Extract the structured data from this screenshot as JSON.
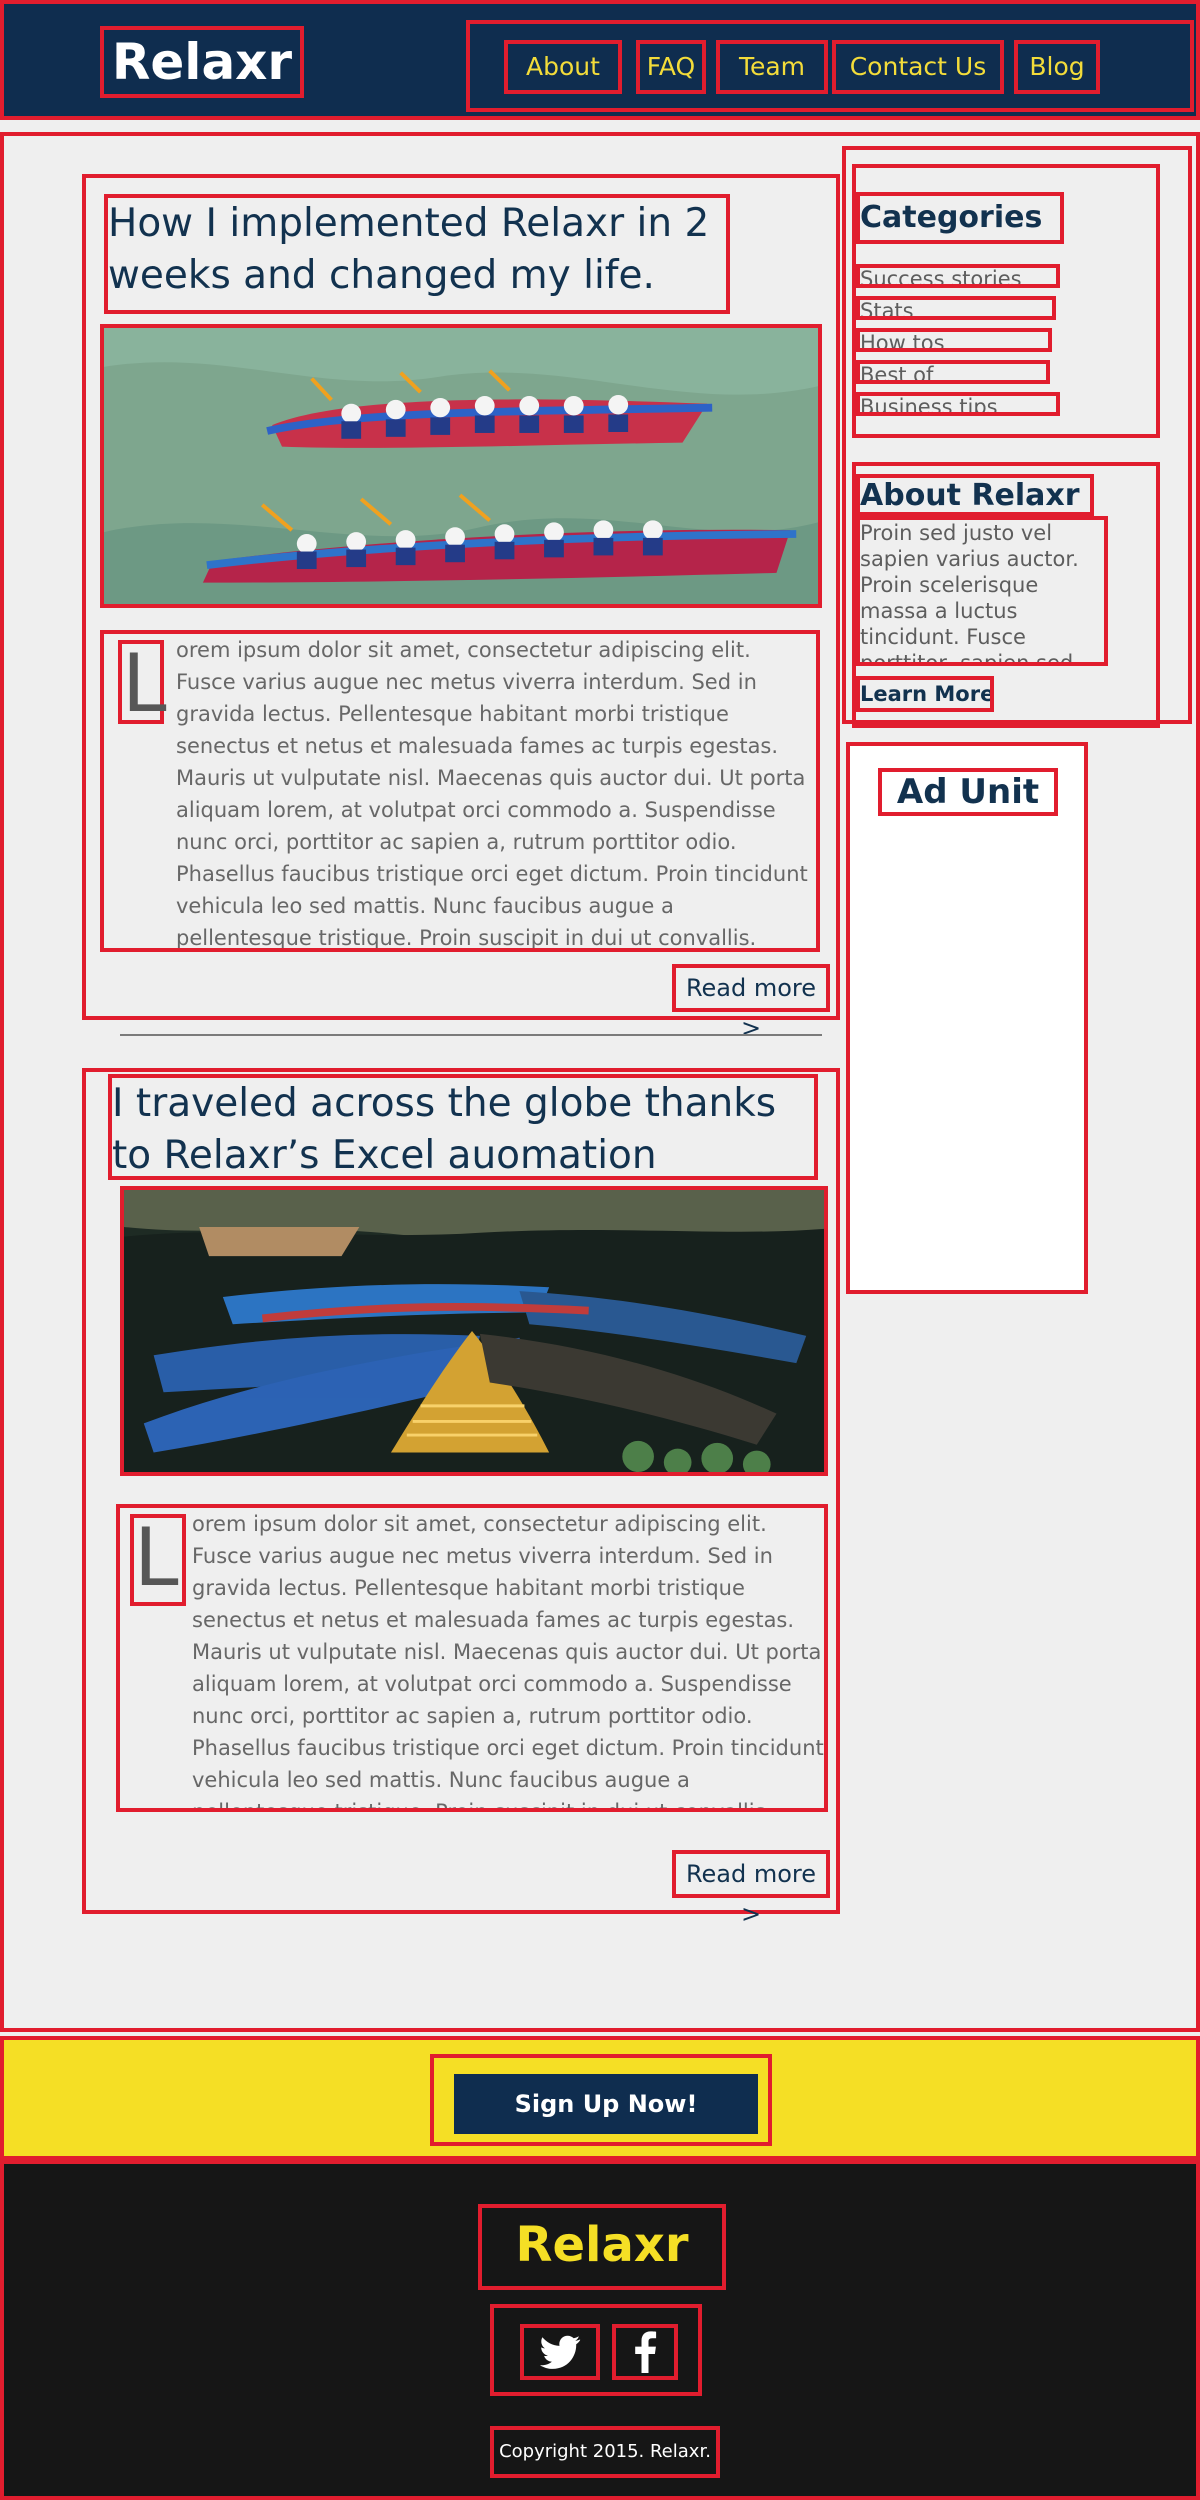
{
  "header": {
    "logo": "Relaxr",
    "nav": [
      "About",
      "FAQ",
      "Team",
      "Contact Us",
      "Blog"
    ]
  },
  "posts": [
    {
      "title": "How I implemented Relaxr in 2 weeks and changed my life.",
      "image": "dragon-boat-race",
      "drop_cap": "L",
      "body": "orem ipsum dolor sit amet, consectetur adipiscing elit. Fusce varius augue nec metus viverra interdum. Sed in gravida lectus. Pellentesque habitant morbi tristique senectus et netus et malesuada fames ac turpis egestas. Mauris ut vulputate nisl. Maecenas quis auctor dui. Ut porta aliquam lorem, at volutpat orci commodo a. Suspendisse nunc orci, porttitor ac sapien a, rutrum porttitor odio. Phasellus faucibus tristique orci eget dictum. Proin tincidunt vehicula leo sed mattis. Nunc faucibus augue a pellentesque tristique. Proin suscipit in dui ut convallis.",
      "read_more": "Read more >"
    },
    {
      "title": "I traveled across the globe thanks to Relaxr’s Excel auomation",
      "image": "colorful-boats-on-lake",
      "drop_cap": "L",
      "body": "orem ipsum dolor sit amet, consectetur adipiscing elit. Fusce varius augue nec metus viverra interdum. Sed in gravida lectus. Pellentesque habitant morbi tristique senectus et netus et malesuada fames ac turpis egestas. Mauris ut vulputate nisl. Maecenas quis auctor dui. Ut porta aliquam lorem, at volutpat orci commodo a. Suspendisse nunc orci, porttitor ac sapien a, rutrum porttitor odio. Phasellus faucibus tristique orci eget dictum. Proin tincidunt vehicula leo sed mattis. Nunc faucibus augue a pellentesque tristique. Proin suscipit in dui ut convallis.",
      "read_more": "Read more >"
    }
  ],
  "sidebar": {
    "categories_title": "Categories",
    "categories": [
      "Success stories",
      "Stats",
      "How tos",
      "Best of",
      "Business tips"
    ],
    "about_title": "About Relaxr",
    "about_text": "Proin sed justo vel sapien varius auctor. Proin scelerisque massa a luctus tincidunt. Fusce porttitor, sapien sed tincidunt fringilla",
    "learn_more": "Learn More"
  },
  "ad_unit": {
    "label": "Ad Unit"
  },
  "signup": {
    "button": "Sign Up Now!"
  },
  "footer": {
    "logo": "Relaxr",
    "social_icons": [
      "twitter-icon",
      "facebook-icon"
    ],
    "copyright": "Copyright 2015. Relaxr."
  },
  "colors": {
    "navy": "#0f2d4f",
    "yellow": "#f5df25",
    "outline": "#e11d2e",
    "background": "#efefef",
    "footer": "#161616"
  }
}
